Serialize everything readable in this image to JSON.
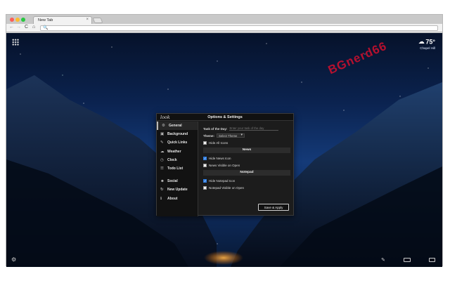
{
  "browser": {
    "tab_title": "New Tab",
    "tab_close": "×",
    "nav_back": "←",
    "nav_forward": "→",
    "nav_reload": "C",
    "nav_home": "⌂",
    "omnibox_icon": "🔍"
  },
  "newtab": {
    "apps_icon": "apps-grid-icon",
    "weather": {
      "temperature": "75°",
      "location": "Chapel Hill",
      "icon": "☁"
    },
    "watermark": "BGnerd66",
    "settings_icon": "⚙",
    "bottom_icons": {
      "note": "✎"
    }
  },
  "panel": {
    "logo": "look",
    "title": "Options & Settings",
    "sidebar": [
      {
        "label": "General",
        "icon": "⚙",
        "active": true
      },
      {
        "label": "Background",
        "icon": "▣"
      },
      {
        "label": "Quick Links",
        "icon": "✎"
      },
      {
        "label": "Weather",
        "icon": "☁"
      },
      {
        "label": "Clock",
        "icon": "◷"
      },
      {
        "label": "Todo List",
        "icon": "☰"
      },
      {
        "label": "Social",
        "icon": "☻"
      },
      {
        "label": "New Update",
        "icon": "↻"
      },
      {
        "label": "About",
        "icon": "ℹ"
      }
    ],
    "general": {
      "task_label": "Task of the Day:",
      "task_placeholder": "Enter your task of the day",
      "theme_label": "Theme:",
      "theme_value": "Select Theme",
      "hide_all_icons": "Hide All Icons",
      "news_section": "News",
      "hide_news_icon": "Hide News Icon",
      "news_visible_open": "News Visible on Open",
      "notepad_section": "Notepad",
      "hide_notepad_icon": "Hide Notepad Icon",
      "notepad_visible_open": "Notepad Visible on Open",
      "save_button": "Save & Apply"
    }
  }
}
